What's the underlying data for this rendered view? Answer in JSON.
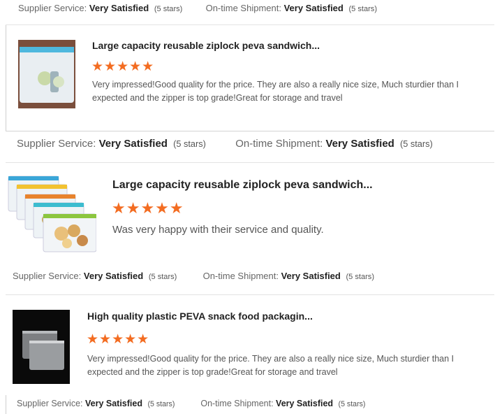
{
  "rating_labels": {
    "supplier": "Supplier Service:",
    "shipment": "On-time Shipment:",
    "value": "Very Satisfied",
    "stars": "(5 stars)"
  },
  "reviews": [
    {
      "title": "Large capacity reusable ziplock peva sandwich...",
      "stars": "★★★★★",
      "text": "Very impressed!Good quality for the price. They are also a really nice size, Much sturdier than I expected and the zipper is top grade!Great for storage and travel",
      "image": "frosted-ziplock-bag-photo"
    },
    {
      "title": "Large capacity reusable ziplock peva sandwich...",
      "stars": "★★★★★",
      "text": "Was very happy with their service and quality.",
      "image": "colorful-ziplock-bags-stack-photo"
    },
    {
      "title": "High quality plastic PEVA snack food packagin...",
      "stars": "★★★★★",
      "text": "Very impressed!Good quality for the price. They are also a really nice size, Much sturdier than I expected and the zipper is top grade!Great for storage and travel",
      "image": "clear-bags-on-black-photo"
    }
  ]
}
